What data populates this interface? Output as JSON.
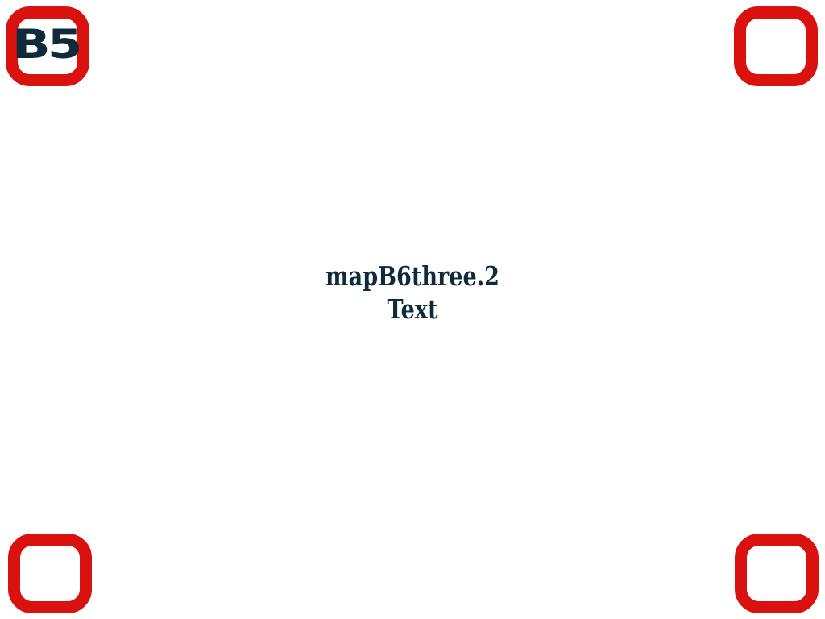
{
  "badge": {
    "label": "B5"
  },
  "center": {
    "title": "mapB6three.2",
    "subtitle": "Text"
  },
  "corners": {
    "shape": "rounded-square-outline",
    "count": 4
  },
  "colors": {
    "background": "#ffffff",
    "corner": "#d9120f",
    "text": "#0f2a3a"
  }
}
